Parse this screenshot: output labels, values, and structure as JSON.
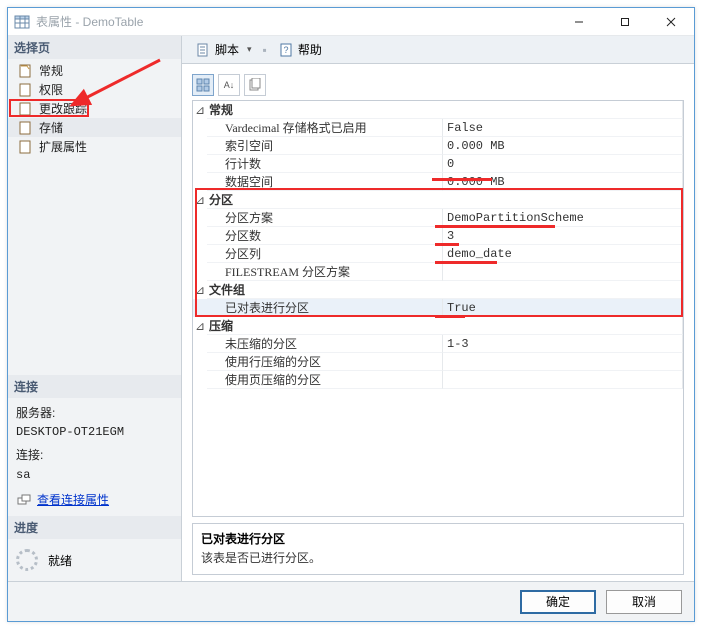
{
  "window": {
    "title": "表属性 - DemoTable"
  },
  "sidebar": {
    "section_select": "选择页",
    "items": [
      {
        "label": "常规"
      },
      {
        "label": "权限"
      },
      {
        "label": "更改跟踪"
      },
      {
        "label": "存储"
      },
      {
        "label": "扩展属性"
      }
    ],
    "section_conn": "连接",
    "conn_server_label": "服务器:",
    "conn_server_value": "DESKTOP-OT21EGM",
    "conn_conn_label": "连接:",
    "conn_conn_value": "sa",
    "conn_link": "查看连接属性",
    "section_progress": "进度",
    "progress_status": "就绪"
  },
  "toolbar": {
    "script": "脚本",
    "help": "帮助"
  },
  "props": {
    "cat_general": "常规",
    "general": [
      {
        "l": "Vardecimal 存储格式已启用",
        "r": "False"
      },
      {
        "l": "索引空间",
        "r": "0.000 MB"
      },
      {
        "l": "行计数",
        "r": "0"
      },
      {
        "l": "数据空间",
        "r": "0.000 MB"
      }
    ],
    "cat_partition": "分区",
    "partition": [
      {
        "l": "分区方案",
        "r": "DemoPartitionScheme"
      },
      {
        "l": "分区数",
        "r": "3"
      },
      {
        "l": "分区列",
        "r": "demo_date"
      },
      {
        "l": "FILESTREAM 分区方案",
        "r": ""
      }
    ],
    "cat_filegroup": "文件组",
    "filegroup": [
      {
        "l": "已对表进行分区",
        "r": "True"
      }
    ],
    "cat_compress": "压缩",
    "compress": [
      {
        "l": "未压缩的分区",
        "r": "1-3"
      },
      {
        "l": "使用行压缩的分区",
        "r": ""
      },
      {
        "l": "使用页压缩的分区",
        "r": ""
      }
    ]
  },
  "desc": {
    "title": "已对表进行分区",
    "text": "该表是否已进行分区。"
  },
  "footer": {
    "ok": "确定",
    "cancel": "取消"
  }
}
